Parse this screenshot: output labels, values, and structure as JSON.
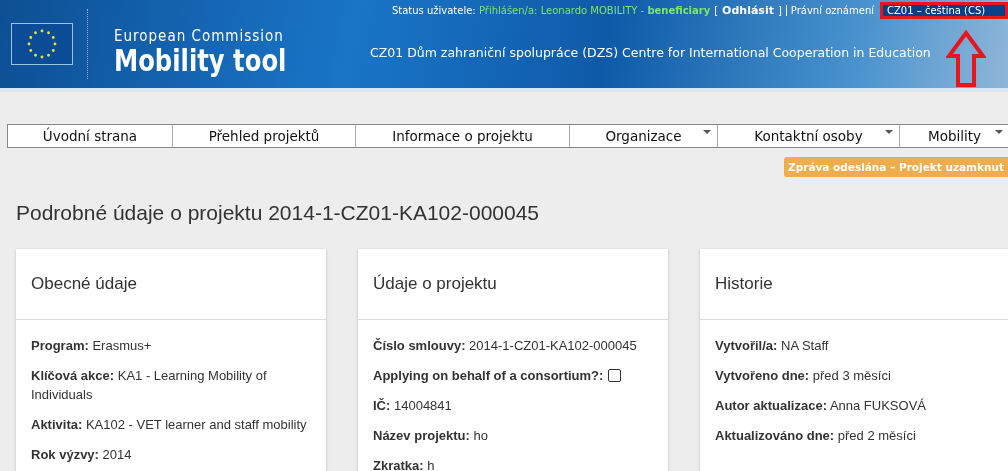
{
  "header": {
    "brand_top": "European Commission",
    "brand_bottom": "Mobility tool",
    "organization": "CZ01 Dům zahraniční spolupráce (DZS) Centre for International Cooperation in Education",
    "status_label": "Status uživatele:",
    "status_value": "Přihlášen/a: Leonardo MOBILITY - ",
    "status_role": "beneficiary",
    "logout_open": "[",
    "logout": "Odhlásit",
    "logout_close": "]",
    "legal": "Právní oznámení",
    "language": "CZ01 – čeština (CS)"
  },
  "nav": [
    {
      "label": "Úvodní strana",
      "has_menu": false
    },
    {
      "label": "Přehled projektů",
      "has_menu": false
    },
    {
      "label": "Informace o projektu",
      "has_menu": false
    },
    {
      "label": "Organizace",
      "has_menu": true
    },
    {
      "label": "Kontaktní osoby",
      "has_menu": true
    },
    {
      "label": "Mobility",
      "has_menu": true
    }
  ],
  "status_badge": "Zpráva odeslána – Projekt uzamknut",
  "page_title": "Podrobné údaje o projektu 2014-1-CZ01-KA102-000045",
  "cards": [
    {
      "title": "Obecné údaje",
      "fields": [
        {
          "kind": "text",
          "label": "Program:",
          "value": "Erasmus+"
        },
        {
          "kind": "text",
          "label": "Klíčová akce:",
          "value": "KA1 - Learning Mobility of Individuals"
        },
        {
          "kind": "text",
          "label": "Aktivita:",
          "value": "KA102 - VET learner and staff mobility"
        },
        {
          "kind": "text",
          "label": "Rok výzvy:",
          "value": "2014"
        }
      ]
    },
    {
      "title": "Údaje o projektu",
      "fields": [
        {
          "kind": "text",
          "label": "Číslo smlouvy:",
          "value": "2014-1-CZ01-KA102-000045"
        },
        {
          "kind": "checkbox",
          "label": "Applying on behalf of a consortium?:",
          "checked": false
        },
        {
          "kind": "text",
          "label": "IČ:",
          "value": "14004841"
        },
        {
          "kind": "text",
          "label": "Název projektu:",
          "value": "ho"
        },
        {
          "kind": "text",
          "label": "Zkratka:",
          "value": "h"
        }
      ]
    },
    {
      "title": "Historie",
      "fields": [
        {
          "kind": "text",
          "label": "Vytvořil/a:",
          "value": "NA Staff"
        },
        {
          "kind": "text",
          "label": "Vytvořeno dne:",
          "value": "před 3 měsíci"
        },
        {
          "kind": "text",
          "label": "Autor aktualizace:",
          "value": "Anna FUKSOVÁ"
        },
        {
          "kind": "text",
          "label": "Aktualizováno dne:",
          "value": "před 2 měsíci"
        }
      ]
    }
  ]
}
